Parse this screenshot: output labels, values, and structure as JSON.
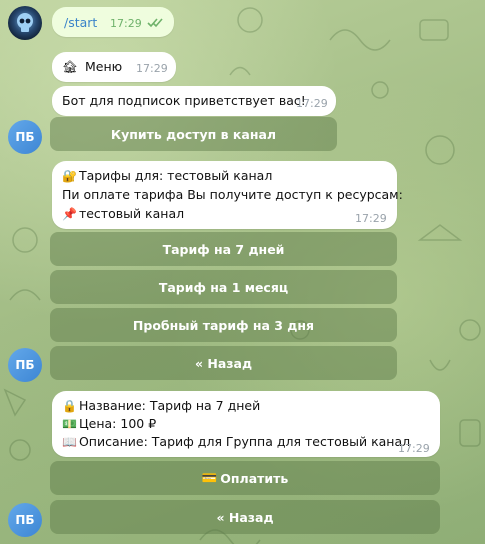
{
  "messages": {
    "start": {
      "text": "/start",
      "time": "17:29"
    },
    "menu": {
      "icon": "🏚",
      "text": "Меню",
      "time": "17:29"
    },
    "greeting": {
      "text": "Бот для подписок приветствует вас!",
      "time": "17:29"
    },
    "tariffs": {
      "line1_icon": "🔐",
      "line1": "Тарифы для: тестовый канал",
      "line2": "Пи оплате тарифа Вы получите доступ к ресурсам:",
      "line3_icon": "📌",
      "line3": "тестовый канал",
      "time": "17:29"
    },
    "details": {
      "line1_icon": "🔒",
      "line1": "Название: Тариф на 7 дней",
      "line2_icon": "💵",
      "line2": "Цена: 100 ₽",
      "line3_icon": "📖",
      "line3": "Описание: Тариф для Группа для тестовый канал",
      "time": "17:29"
    }
  },
  "keyboards": {
    "buy_access": "Купить доступ в канал",
    "tariff_7": "Тариф на 7 дней",
    "tariff_month": "Тариф на 1 месяц",
    "tariff_trial": "Пробный тариф на 3 дня",
    "back1": "« Назад",
    "pay_icon": "💳",
    "pay": "Оплатить",
    "back2": "« Назад"
  },
  "avatars": {
    "bot_initials": "ПБ"
  },
  "colors": {
    "background": "#a9c28d",
    "outgoing_bubble": "#effdde",
    "incoming_bubble": "#ffffff",
    "bot_avatar": "#4f97e0",
    "read_check": "#6fb26b"
  }
}
